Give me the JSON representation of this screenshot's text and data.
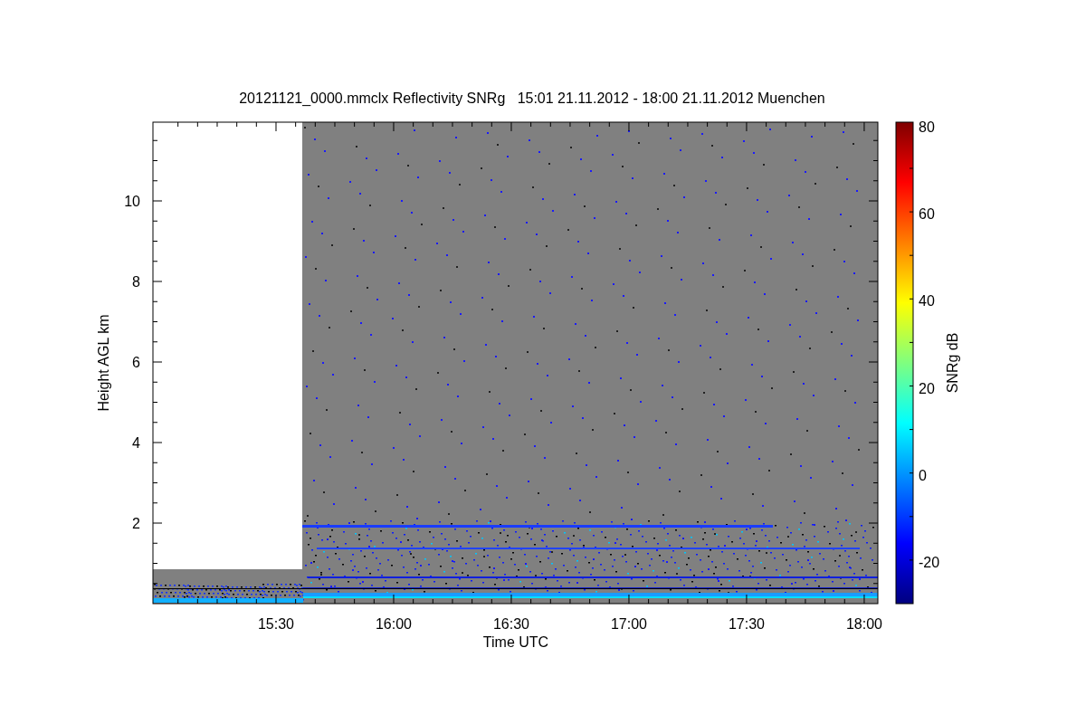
{
  "chart_title": "20121121_0000.mmclx Reflectivity SNRg   15:01 21.11.2012 - 18:00 21.11.2012 Muenchen",
  "y_axis": {
    "label": "Height AGL km",
    "ticks": [
      "10",
      "8",
      "6",
      "4",
      "2"
    ]
  },
  "x_axis": {
    "label": "Time UTC",
    "ticks": [
      "15:30",
      "16:00",
      "16:30",
      "17:00",
      "17:30",
      "18:00"
    ]
  },
  "colorbar": {
    "label": "SNRg dB",
    "ticks": [
      "80",
      "60",
      "40",
      "20",
      "0",
      "-20"
    ]
  }
}
